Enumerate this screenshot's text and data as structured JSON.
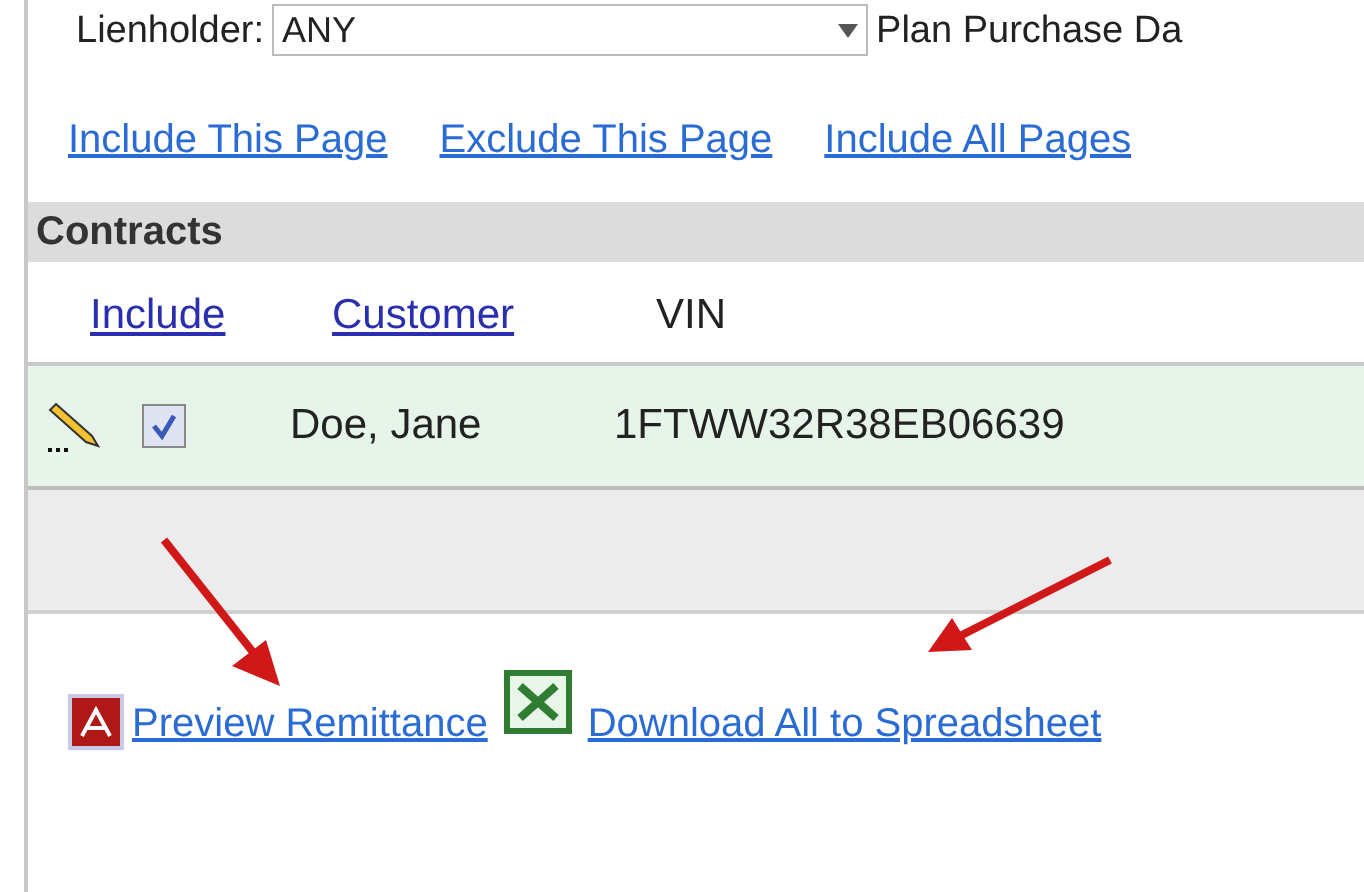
{
  "filter_row": {
    "label": "Lienholder:",
    "select_value": "ANY",
    "next_label": "Plan Purchase Da"
  },
  "page_links": [
    "Include This Page",
    "Exclude This Page",
    "Include All Pages"
  ],
  "section": {
    "title": "Contracts"
  },
  "table": {
    "columns": [
      {
        "label": "Include",
        "kind": "link"
      },
      {
        "label": "Customer",
        "kind": "link"
      },
      {
        "label": "VIN",
        "kind": "text"
      }
    ],
    "rows": [
      {
        "checked": true,
        "customer": "Doe, Jane",
        "vin": "1FTWW32R38EB06639"
      }
    ]
  },
  "actions": [
    {
      "kind": "pdf",
      "label": "Preview Remittance"
    },
    {
      "kind": "spreadsheet",
      "label": "Download All to Spreadsheet"
    }
  ]
}
